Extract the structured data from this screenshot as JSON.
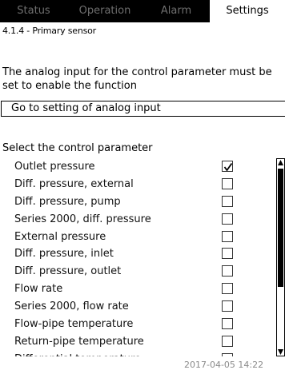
{
  "tabs": [
    {
      "label": "Status",
      "active": false
    },
    {
      "label": "Operation",
      "active": false
    },
    {
      "label": "Alarm",
      "active": false
    },
    {
      "label": "Settings",
      "active": true
    }
  ],
  "breadcrumb": "4.1.4 - Primary sensor",
  "message": "The analog input for the control parameter must be set to enable the function",
  "action_button": "Go to setting of analog input",
  "section_title": "Select the control parameter",
  "parameters": [
    {
      "label": "Outlet pressure",
      "checked": true
    },
    {
      "label": "Diff. pressure, external",
      "checked": false
    },
    {
      "label": "Diff. pressure, pump",
      "checked": false
    },
    {
      "label": "Series 2000, diff. pressure",
      "checked": false
    },
    {
      "label": "External pressure",
      "checked": false
    },
    {
      "label": "Diff. pressure, inlet",
      "checked": false
    },
    {
      "label": "Diff. pressure, outlet",
      "checked": false
    },
    {
      "label": "Flow rate",
      "checked": false
    },
    {
      "label": "Series 2000, flow rate",
      "checked": false
    },
    {
      "label": "Flow-pipe temperature",
      "checked": false
    },
    {
      "label": "Return-pipe temperature",
      "checked": false
    },
    {
      "label": "Differential temperature",
      "checked": false
    }
  ],
  "footer_datetime": "2017-04-05 14:22",
  "colors": {
    "tabbar_bg": "#000000",
    "tab_inactive_text": "#6f6f6f",
    "footer_text": "#8a8a8a"
  },
  "icons": {
    "check": "check-icon",
    "scroll_up": "scroll-up-arrow-icon",
    "scroll_down": "scroll-down-arrow-icon"
  }
}
